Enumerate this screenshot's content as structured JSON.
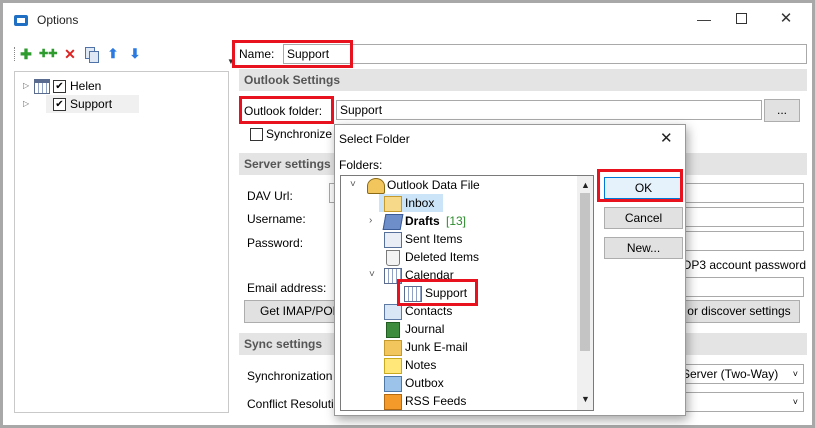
{
  "window": {
    "title": "Options",
    "minimize_glyph": "—",
    "close_glyph": "✕"
  },
  "toolbar": {
    "icons": [
      "add-icon",
      "add-multiple-icon",
      "delete-icon",
      "copy-icon",
      "move-up-icon",
      "move-down-icon"
    ]
  },
  "profiles_tree": {
    "items": [
      {
        "label": "Helen",
        "checked": true
      },
      {
        "label": "Support",
        "checked": true,
        "selected": true
      }
    ]
  },
  "profile": {
    "name_label": "Name:",
    "name_value": "Support"
  },
  "outlook_settings": {
    "header": "Outlook Settings",
    "folder_label": "Outlook folder:",
    "folder_value": "Support",
    "browse_label": "...",
    "synchronize_label": "Synchronize"
  },
  "server_settings": {
    "header": "Server settings",
    "dav_url_label": "DAV Url:",
    "username_label": "Username:",
    "password_label": "Password:",
    "pop3_password_text": "OP3 account password",
    "email_label": "Email address:",
    "get_imap_button": "Get IMAP/POF",
    "discover_button": "or discover settings"
  },
  "sync_settings": {
    "header": "Sync settings",
    "synchronization_label": "Synchronization",
    "synchronization_value": "Server (Two-Way)",
    "conflict_label": "Conflict Resolutio"
  },
  "dialog": {
    "title": "Select Folder",
    "close_glyph": "✕",
    "folders_label": "Folders:",
    "ok_label": "OK",
    "cancel_label": "Cancel",
    "new_label": "New...",
    "folders": {
      "root": "Outlook Data File",
      "inbox": "Inbox",
      "drafts": "Drafts",
      "drafts_count": "[13]",
      "sent": "Sent Items",
      "deleted": "Deleted Items",
      "calendar": "Calendar",
      "support": "Support",
      "contacts": "Contacts",
      "journal": "Journal",
      "junk": "Junk E-mail",
      "notes": "Notes",
      "outbox": "Outbox",
      "rss": "RSS Feeds"
    }
  },
  "colors": {
    "highlight": "#e8121f",
    "section_bg": "#e4e4e4",
    "selection": "#cce4f7"
  }
}
